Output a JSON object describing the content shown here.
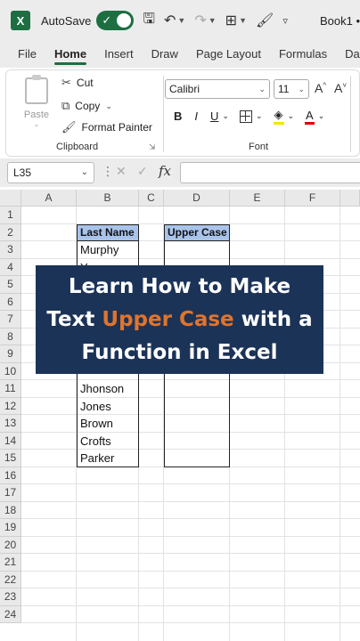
{
  "titlebar": {
    "app_icon": "excel-logo",
    "app_letter": "X",
    "autosave_label": "AutoSave",
    "autosave_on": true,
    "book_title": "Book1 •"
  },
  "tabs": [
    "File",
    "Home",
    "Insert",
    "Draw",
    "Page Layout",
    "Formulas",
    "Dat"
  ],
  "active_tab": "Home",
  "ribbon": {
    "clipboard": {
      "paste_label": "Paste",
      "cut_label": "Cut",
      "copy_label": "Copy",
      "format_painter_label": "Format Painter",
      "group_label": "Clipboard"
    },
    "font": {
      "font_name": "Calibri",
      "font_size": "11",
      "group_label": "Font",
      "bold": "B",
      "italic": "I",
      "underline": "U",
      "grow": "A^",
      "shrink": "A˅",
      "color_letter": "A"
    }
  },
  "formula_bar": {
    "name_box": "L35",
    "fx_label": "fx",
    "formula": ""
  },
  "sheet": {
    "columns": [
      "A",
      "B",
      "C",
      "D",
      "E",
      "F"
    ],
    "rows": [
      "1",
      "2",
      "3",
      "4",
      "5",
      "6",
      "7",
      "8",
      "9",
      "10",
      "11",
      "12",
      "13",
      "14",
      "15",
      "16",
      "17",
      "18",
      "19",
      "20",
      "21",
      "22",
      "23",
      "24"
    ],
    "header_b": "Last Name",
    "header_d": "Upper Case",
    "last_names": [
      {
        "row": "3",
        "value": "Murphy"
      },
      {
        "row": "4",
        "value": "Young"
      },
      {
        "row": "11",
        "value": "Jhonson"
      },
      {
        "row": "12",
        "value": "Jones"
      },
      {
        "row": "13",
        "value": "Brown"
      },
      {
        "row": "14",
        "value": "Crofts"
      },
      {
        "row": "15",
        "value": "Parker"
      }
    ]
  },
  "banner": {
    "line1": "Learn How to Make",
    "line2_pre": "Text ",
    "line2_accent": "Upper Case",
    "line2_post": " with a",
    "line3": "Function in Excel"
  },
  "colors": {
    "excel_green": "#1d6f42",
    "banner_bg": "#1c3358",
    "banner_accent": "#e0742d",
    "header_fill": "#a9c4eb"
  }
}
